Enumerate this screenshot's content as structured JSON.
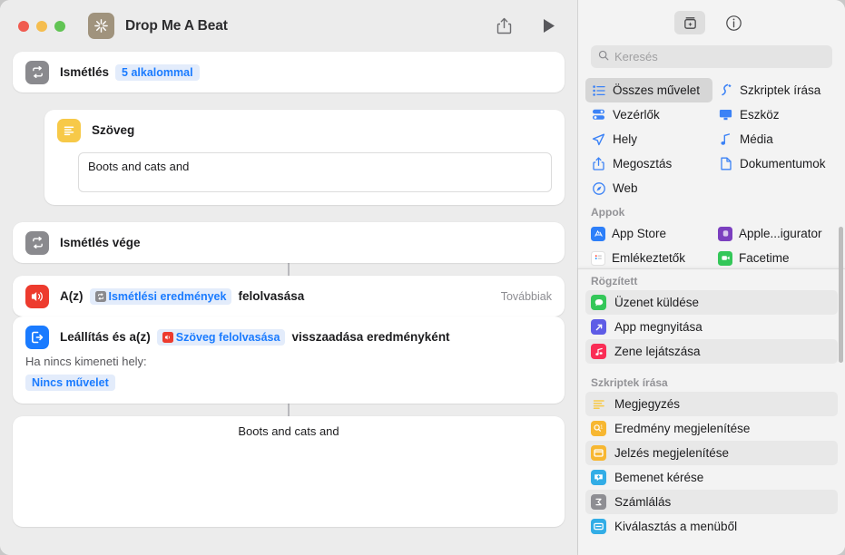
{
  "window": {
    "title": "Drop Me A Beat",
    "app_icon": "shortcuts-icon",
    "traffic_lights": [
      "close-button",
      "minimize-button",
      "maximize-button"
    ],
    "toolbar": {
      "share_label": "share-icon",
      "run_label": "play-icon"
    }
  },
  "workflow": {
    "actions": [
      {
        "name": "repeat",
        "icon": "repeat-icon",
        "label": "Ismétlés",
        "token": "5 alkalommal"
      },
      {
        "name": "text",
        "icon": "text-icon",
        "label": "Szöveg",
        "value": "Boots and cats and"
      },
      {
        "name": "repeat-end",
        "icon": "repeat-icon",
        "label": "Ismétlés vége"
      },
      {
        "name": "speak-text",
        "icon": "speaker-icon",
        "label_before": "A(z)",
        "token": "Ismétlési eredmények",
        "token_icon": "repeat-chip-icon",
        "label_after": "felolvasása",
        "more": "Továbbiak"
      },
      {
        "name": "stop-and-output",
        "icon": "stop-output-icon",
        "label_before": "Leállítás és a(z)",
        "token": "Szöveg felolvasása",
        "token_icon": "speaker-chip-icon",
        "label_after": "visszaadása eredményként",
        "sub_label": "Ha nincs kimeneti hely:",
        "no_action": "Nincs művelet"
      }
    ],
    "output_preview": "Boots and cats and"
  },
  "library": {
    "toolbar": {
      "add_action": "add-action-icon",
      "info": "info-icon"
    },
    "search": {
      "placeholder": "Keresés",
      "value": "",
      "icon": "search-icon"
    },
    "categories": [
      {
        "label": "Összes művelet",
        "icon": "list-icon",
        "selected": true
      },
      {
        "label": "Szkriptek írása",
        "icon": "scripting-icon",
        "selected": false
      },
      {
        "label": "Vezérlők",
        "icon": "controls-icon",
        "selected": false
      },
      {
        "label": "Eszköz",
        "icon": "device-icon",
        "selected": false
      },
      {
        "label": "Hely",
        "icon": "location-icon",
        "selected": false
      },
      {
        "label": "Média",
        "icon": "music-note-icon",
        "selected": false
      },
      {
        "label": "Megosztás",
        "icon": "share-icon",
        "selected": false
      },
      {
        "label": "Dokumentumok",
        "icon": "document-icon",
        "selected": false
      },
      {
        "label": "Web",
        "icon": "safari-icon",
        "selected": false
      }
    ],
    "apps_section": {
      "title": "Appok",
      "items": [
        {
          "label": "App Store",
          "icon": "app-store-icon",
          "color": "#2d7ff9"
        },
        {
          "label": "Apple...igurator",
          "icon": "apple-configurator-icon",
          "color": "#7b3fbf"
        },
        {
          "label": "Emlékeztetők",
          "icon": "reminders-icon",
          "color": "#ffffff"
        },
        {
          "label": "Facetime",
          "icon": "facetime-icon",
          "color": "#34c759"
        }
      ]
    },
    "pinned_section": {
      "title": "Rögzített",
      "items": [
        {
          "label": "Üzenet küldése",
          "icon": "messages-icon",
          "color": "#34c759"
        },
        {
          "label": "App megnyitása",
          "icon": "open-app-icon",
          "color": "#5e5ce6"
        },
        {
          "label": "Zene lejátszása",
          "icon": "music-icon",
          "color": "#fa2d55"
        }
      ]
    },
    "scripting_section": {
      "title": "Szkriptek írása",
      "items": [
        {
          "label": "Megjegyzés",
          "icon": "comment-icon",
          "color": "#f7c948"
        },
        {
          "label": "Eredmény megjelenítése",
          "icon": "show-result-icon",
          "color": "#f7b731"
        },
        {
          "label": "Jelzés megjelenítése",
          "icon": "show-alert-icon",
          "color": "#f7b731"
        },
        {
          "label": "Bemenet kérése",
          "icon": "ask-input-icon",
          "color": "#32ade6"
        },
        {
          "label": "Számlálás",
          "icon": "count-icon",
          "color": "#8e8e93"
        },
        {
          "label": "Kiválasztás a menüből",
          "icon": "choose-menu-icon",
          "color": "#32ade6"
        }
      ]
    }
  },
  "colors": {
    "accent": "#1a7bff",
    "token_bg": "#e3ecfb",
    "window_bg": "#ececec",
    "sidebar_bg": "#f3f3f3"
  }
}
